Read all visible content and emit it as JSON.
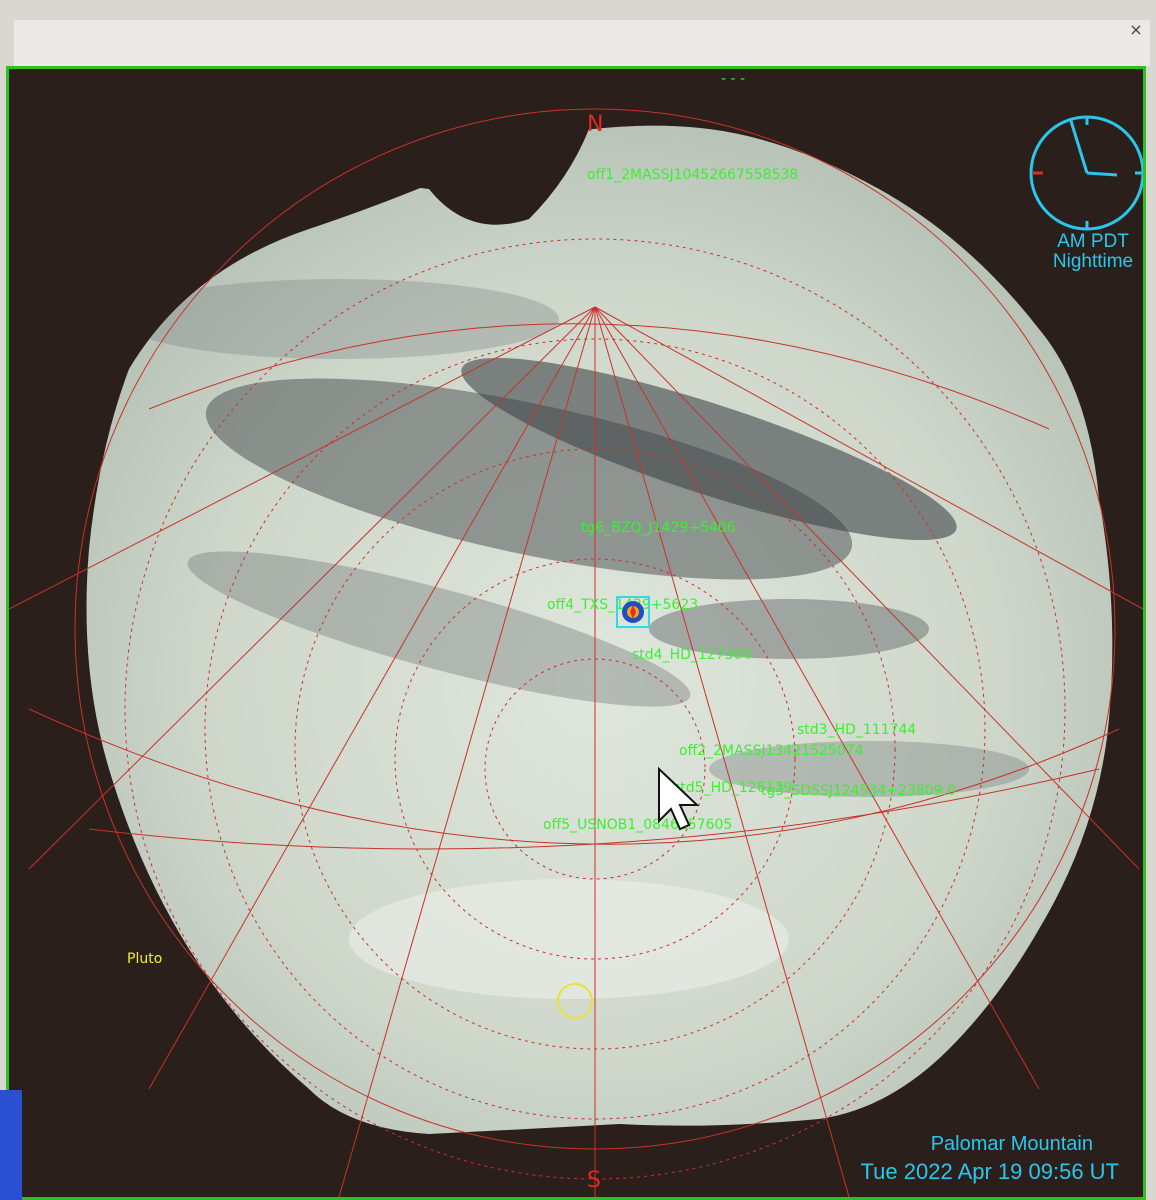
{
  "window": {
    "close_glyph": "×",
    "top_marks": "- -  -"
  },
  "compass": {
    "north": "N",
    "south": "S"
  },
  "clock": {
    "line1": "AM PDT",
    "line2": "Nighttime"
  },
  "targets": [
    {
      "label": "off1_2MASSJ10452667558538"
    },
    {
      "label": "tg6_BZQ_J1429+5406"
    },
    {
      "label": "off4_TXS_1429+5623"
    },
    {
      "label": "std4_HD_127304"
    },
    {
      "label": "std3_HD_111744"
    },
    {
      "label": "off2_2MASSJ13421525074"
    },
    {
      "label": "std5_HD_126129"
    },
    {
      "label": "tg3_SDSSJ124534+23809.0"
    },
    {
      "label": "off5_USNOB1_0846257605"
    },
    {
      "label": "Pluto"
    }
  ],
  "footer": {
    "location": "Palomar Mountain",
    "datetime": "Tue  2022 Apr 19  09:56 UT"
  },
  "colors": {
    "grid": "#c8322a",
    "target_label": "#3cf030",
    "planet_label": "#f2f22a",
    "info_text": "#29c7ee",
    "window_border": "#2ec21f",
    "cursor": "#ffffff"
  },
  "icons": {
    "clock": "clock-icon",
    "cursor": "mouse-pointer-icon",
    "telescope_marker": "telescope-target-icon",
    "moon_marker": "moon-circle-icon"
  }
}
